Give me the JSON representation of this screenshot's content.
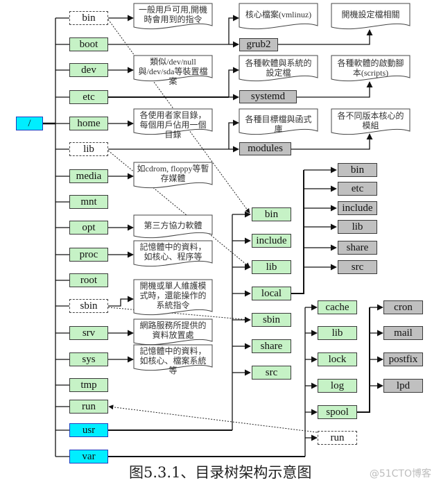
{
  "title": "目录树架构示意图",
  "caption": "图5.3.1、目录树架构示意图",
  "watermark": "@51CTO博客",
  "colors": {
    "green": "#c6f2c6",
    "gray": "#c0c0c0",
    "cyan": "#00eeff",
    "line": "#111111"
  },
  "root": {
    "label": "/"
  },
  "top_level": [
    {
      "label": "bin",
      "style": "dashed"
    },
    {
      "label": "boot",
      "style": "green"
    },
    {
      "label": "dev",
      "style": "green"
    },
    {
      "label": "etc",
      "style": "green"
    },
    {
      "label": "home",
      "style": "green"
    },
    {
      "label": "lib",
      "style": "dashed"
    },
    {
      "label": "media",
      "style": "green"
    },
    {
      "label": "mnt",
      "style": "green"
    },
    {
      "label": "opt",
      "style": "green"
    },
    {
      "label": "proc",
      "style": "green"
    },
    {
      "label": "root",
      "style": "green"
    },
    {
      "label": "sbin",
      "style": "dashed"
    },
    {
      "label": "srv",
      "style": "green"
    },
    {
      "label": "sys",
      "style": "green"
    },
    {
      "label": "tmp",
      "style": "green"
    },
    {
      "label": "run",
      "style": "green"
    },
    {
      "label": "usr",
      "style": "cyan"
    },
    {
      "label": "var",
      "style": "cyan"
    }
  ],
  "notes": {
    "bin": "一般用戶可用,開機時會用到的指令",
    "dev": "類似/dev/null與/dev/sda等裝置檔案",
    "home": "各使用者家目錄，每個用戶佔用一個目錄",
    "media": "如cdrom, floppy等暫存媒體",
    "opt": "第三方協力軟體",
    "proc": "記憶體中的資料，如核心、程序等",
    "sbin": "開機或單人維護模式時，還能操作的系統指令",
    "srv": "網路服務所提供的資料放置處",
    "sys": "記憶體中的資料，如核心、檔案系統等",
    "boot_kernel": "核心檔案(vmlinuz)",
    "grub2": "開機設定檔相關",
    "etc_config": "各種軟體與系統的設定檔",
    "systemd": "各種軟體的啟動腳本(scripts)",
    "lib_files": "各種目標檔與函式庫",
    "modules": "各不同版本核心的模組"
  },
  "second_level": {
    "boot": [
      "grub2"
    ],
    "etc": [
      "systemd"
    ],
    "lib": [
      "modules"
    ],
    "usr": [
      "bin",
      "include",
      "lib",
      "local",
      "sbin",
      "share",
      "src"
    ],
    "usr_local": [
      "bin",
      "etc",
      "include",
      "lib",
      "share",
      "src"
    ],
    "var": [
      "cache",
      "lib",
      "lock",
      "log",
      "spool",
      "run"
    ],
    "var_spool": [
      "cron",
      "mail",
      "postfix",
      "lpd"
    ]
  }
}
